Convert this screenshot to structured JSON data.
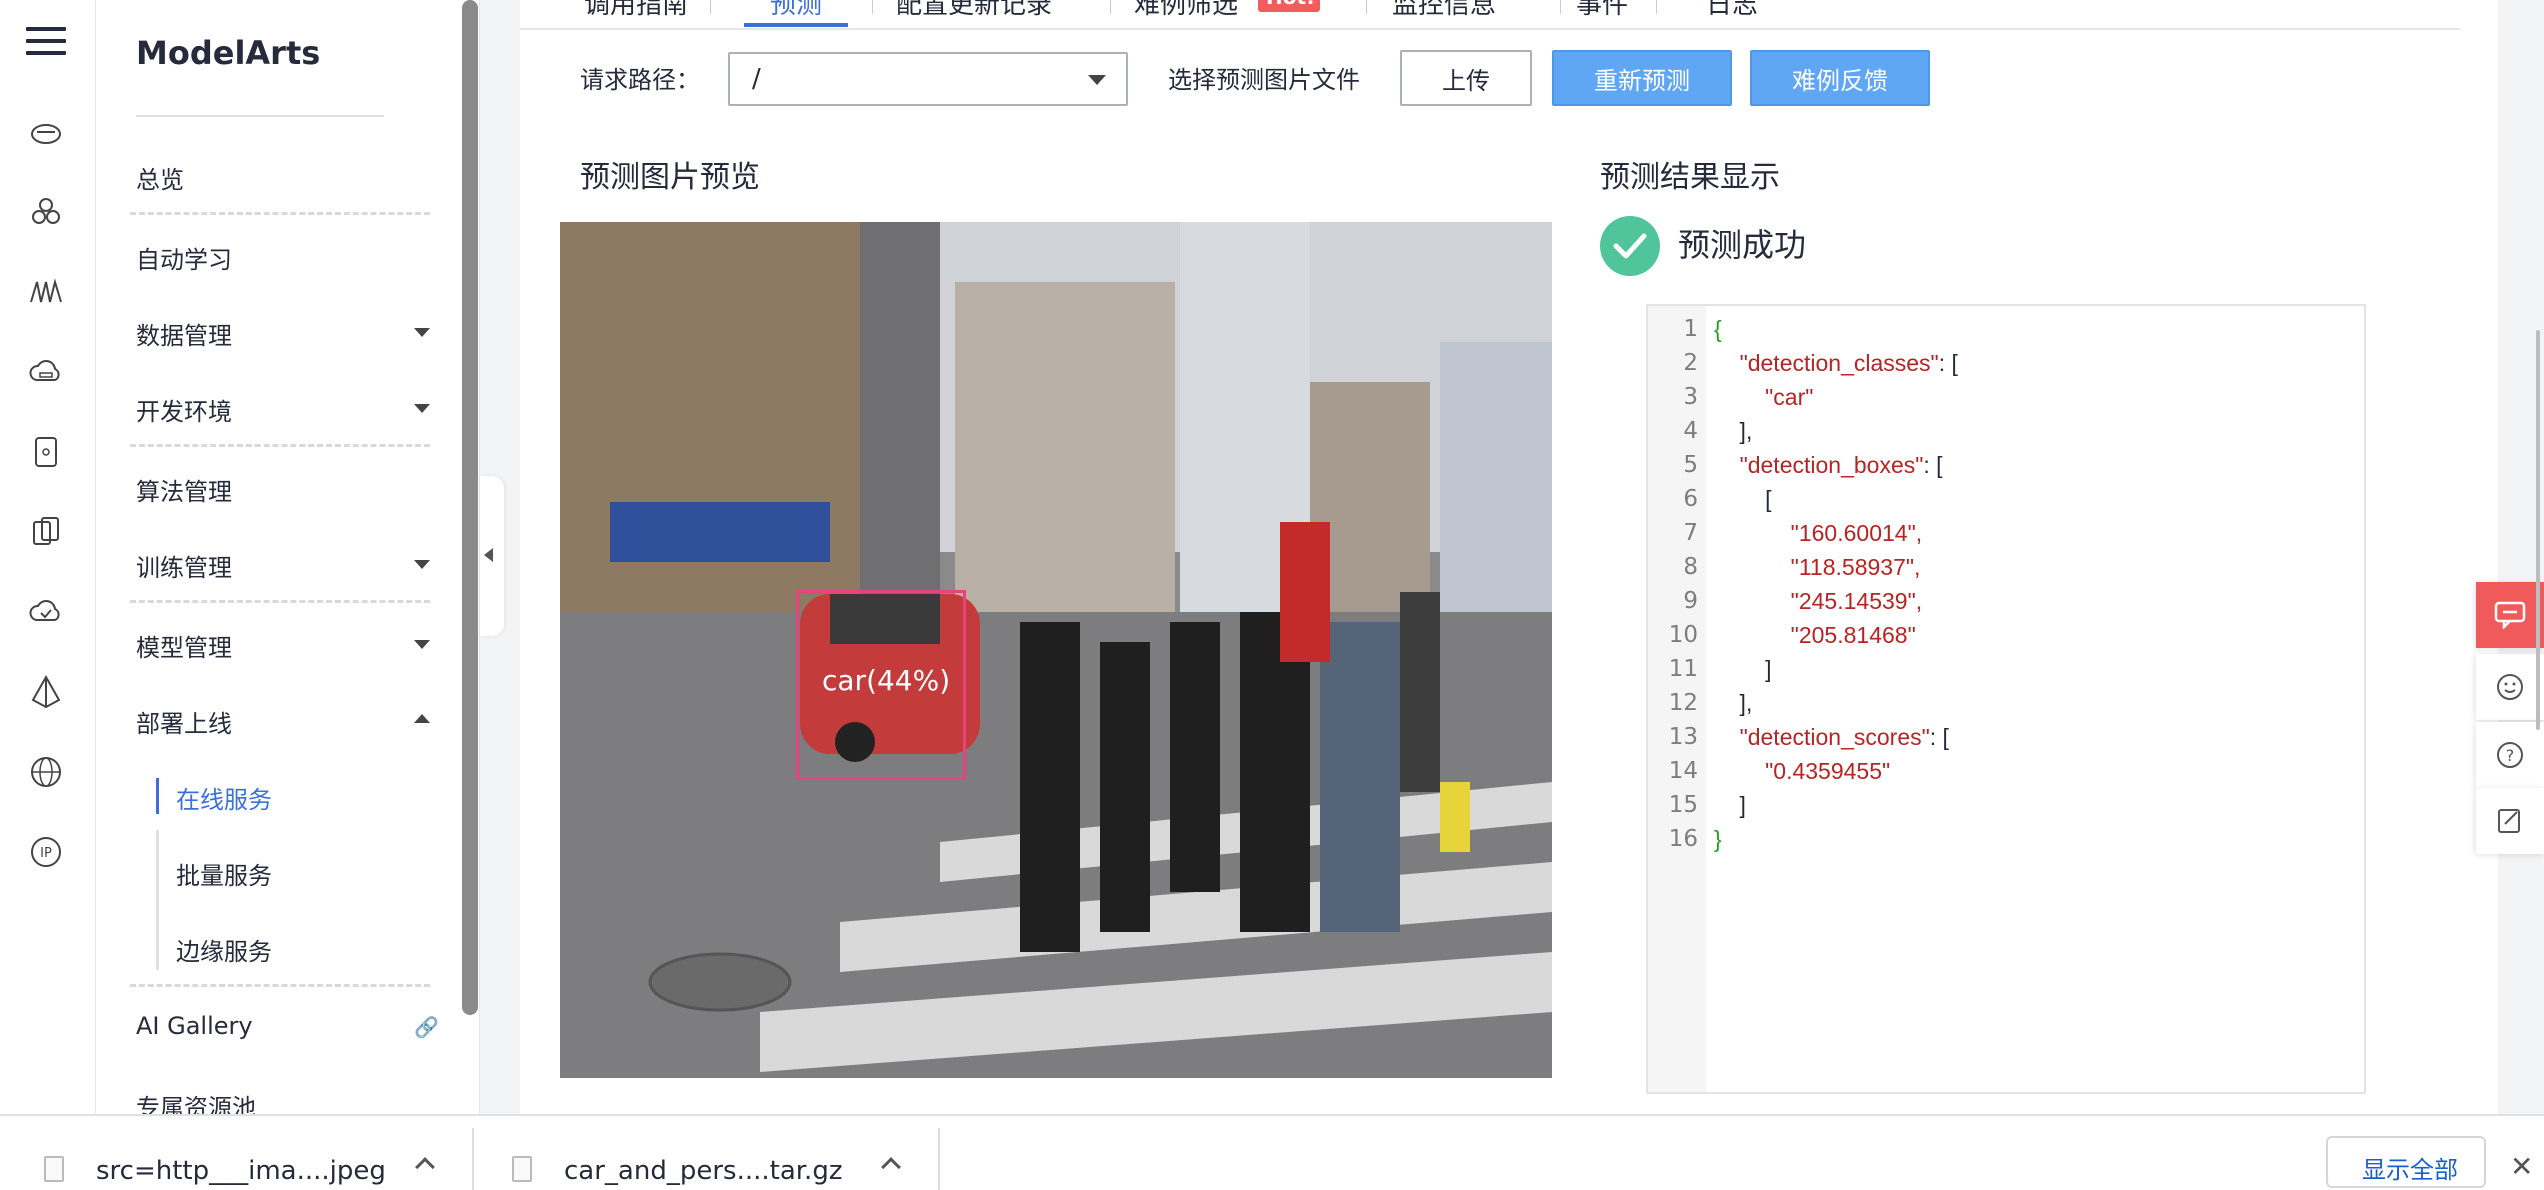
{
  "nav": {
    "brand": "ModelArts",
    "items": {
      "overview": "总览",
      "autolearn": "自动学习",
      "data": "数据管理",
      "devenv": "开发环境",
      "algo": "算法管理",
      "train": "训练管理",
      "model": "模型管理",
      "deploy": "部署上线",
      "online": "在线服务",
      "batch": "批量服务",
      "edge": "边缘服务",
      "gallery": "AI Gallery",
      "pool": "专属资源池"
    }
  },
  "tabs": [
    "调用指南",
    "预测",
    "配置更新记录",
    "难例筛选",
    "监控信息",
    "事件",
    "日志"
  ],
  "hot_badge": "Hot!",
  "toolbar": {
    "path_label": "请求路径：",
    "path_value": "/",
    "file_label": "选择预测图片文件",
    "upload": "上传",
    "repredict": "重新预测",
    "feedback": "难例反馈"
  },
  "preview_title": "预测图片预览",
  "result_title": "预测结果显示",
  "success_text": "预测成功",
  "detection_label": "car(44%)",
  "code_lines": [
    {
      "n": "1",
      "t": "{"
    },
    {
      "n": "2",
      "t": "    \"detection_classes\": ["
    },
    {
      "n": "3",
      "t": "        \"car\""
    },
    {
      "n": "4",
      "t": "    ],"
    },
    {
      "n": "5",
      "t": "    \"detection_boxes\": ["
    },
    {
      "n": "6",
      "t": "        ["
    },
    {
      "n": "7",
      "t": "            \"160.60014\","
    },
    {
      "n": "8",
      "t": "            \"118.58937\","
    },
    {
      "n": "9",
      "t": "            \"245.14539\","
    },
    {
      "n": "10",
      "t": "            \"205.81468\""
    },
    {
      "n": "11",
      "t": "        ]"
    },
    {
      "n": "12",
      "t": "    ],"
    },
    {
      "n": "13",
      "t": "    \"detection_scores\": ["
    },
    {
      "n": "14",
      "t": "        \"0.4359455\""
    },
    {
      "n": "15",
      "t": "    ]"
    },
    {
      "n": "16",
      "t": "}"
    }
  ],
  "downloads": [
    {
      "name": "src=http___ima....jpeg"
    },
    {
      "name": "car_and_pers....tar.gz"
    }
  ],
  "show_all": "显示全部",
  "colors": {
    "accent": "#3d6fd8",
    "primary_button": "#5fa7f5",
    "success": "#50c49a",
    "hot": "#f25c5c",
    "bbox": "#e6447a"
  }
}
